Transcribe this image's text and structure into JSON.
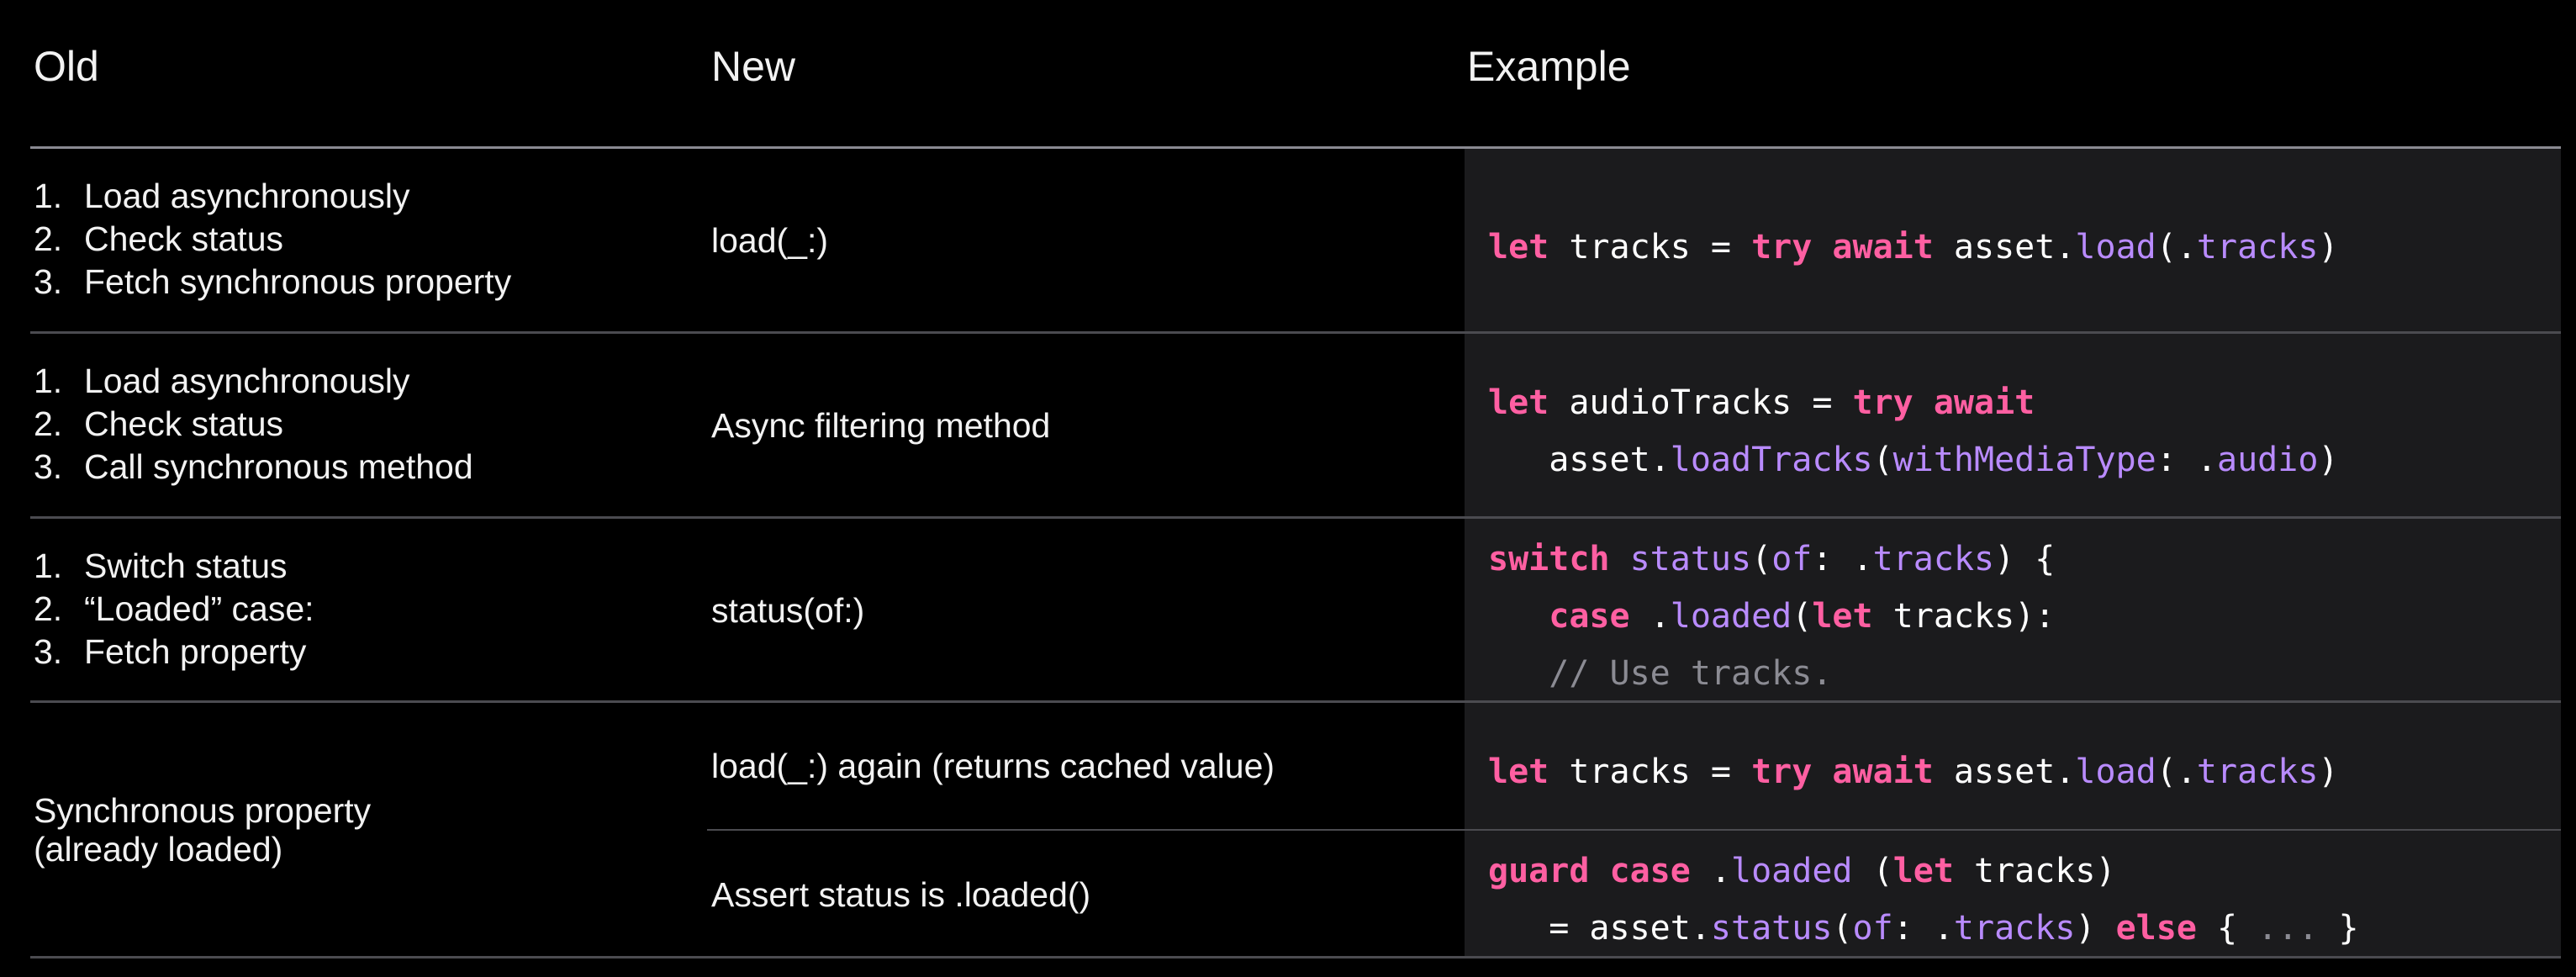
{
  "headers": {
    "old": "Old",
    "new": "New",
    "example": "Example"
  },
  "rows": [
    {
      "old_items": [
        {
          "num": "1.",
          "text": "Load asynchronously"
        },
        {
          "num": "2.",
          "text": "Check status"
        },
        {
          "num": "3.",
          "text": "Fetch synchronous property"
        }
      ],
      "new": "load(_:)",
      "code_lines": [
        [
          {
            "t": "let",
            "c": "kw"
          },
          {
            "t": " tracks = ",
            "c": "pl"
          },
          {
            "t": "try",
            "c": "kw"
          },
          {
            "t": " ",
            "c": "pl"
          },
          {
            "t": "await",
            "c": "kw"
          },
          {
            "t": " asset.",
            "c": "pl"
          },
          {
            "t": "load",
            "c": "fn"
          },
          {
            "t": "(.",
            "c": "pl"
          },
          {
            "t": "tracks",
            "c": "fn"
          },
          {
            "t": ")",
            "c": "pl"
          }
        ]
      ]
    },
    {
      "old_items": [
        {
          "num": "1.",
          "text": "Load asynchronously"
        },
        {
          "num": "2.",
          "text": "Check status"
        },
        {
          "num": "3.",
          "text": "Call synchronous method"
        }
      ],
      "new": "Async filtering method",
      "code_lines": [
        [
          {
            "t": "let",
            "c": "kw"
          },
          {
            "t": " audioTracks = ",
            "c": "pl"
          },
          {
            "t": "try",
            "c": "kw"
          },
          {
            "t": " ",
            "c": "pl"
          },
          {
            "t": "await",
            "c": "kw"
          }
        ],
        [
          {
            "t": "   asset.",
            "c": "pl"
          },
          {
            "t": "loadTracks",
            "c": "fn"
          },
          {
            "t": "(",
            "c": "pl"
          },
          {
            "t": "withMediaType",
            "c": "fn"
          },
          {
            "t": ": .",
            "c": "pl"
          },
          {
            "t": "audio",
            "c": "fn"
          },
          {
            "t": ")",
            "c": "pl"
          }
        ]
      ]
    },
    {
      "old_items": [
        {
          "num": "1.",
          "text": "Switch status"
        },
        {
          "num": "2.",
          "text": "“Loaded” case:"
        },
        {
          "num": "3.",
          "text": "Fetch property"
        }
      ],
      "new": "status(of:)",
      "code_lines": [
        [
          {
            "t": "switch",
            "c": "kw"
          },
          {
            "t": " ",
            "c": "pl"
          },
          {
            "t": "status",
            "c": "fn"
          },
          {
            "t": "(",
            "c": "pl"
          },
          {
            "t": "of",
            "c": "fn"
          },
          {
            "t": ": .",
            "c": "pl"
          },
          {
            "t": "tracks",
            "c": "fn"
          },
          {
            "t": ") {",
            "c": "pl"
          }
        ],
        [
          {
            "t": "   ",
            "c": "pl"
          },
          {
            "t": "case",
            "c": "kw"
          },
          {
            "t": " .",
            "c": "pl"
          },
          {
            "t": "loaded",
            "c": "fn"
          },
          {
            "t": "(",
            "c": "pl"
          },
          {
            "t": "let",
            "c": "kw"
          },
          {
            "t": " tracks):",
            "c": "pl"
          }
        ],
        [
          {
            "t": "   // Use tracks.",
            "c": "cm"
          }
        ]
      ]
    },
    {
      "old_text_1": "Synchronous property",
      "old_text_2": "(already loaded)",
      "sub_rows": [
        {
          "new": "load(_:) again (returns cached value)",
          "code_lines": [
            [
              {
                "t": "let",
                "c": "kw"
              },
              {
                "t": " tracks = ",
                "c": "pl"
              },
              {
                "t": "try",
                "c": "kw"
              },
              {
                "t": " ",
                "c": "pl"
              },
              {
                "t": "await",
                "c": "kw"
              },
              {
                "t": " asset.",
                "c": "pl"
              },
              {
                "t": "load",
                "c": "fn"
              },
              {
                "t": "(.",
                "c": "pl"
              },
              {
                "t": "tracks",
                "c": "fn"
              },
              {
                "t": ")",
                "c": "pl"
              }
            ]
          ]
        },
        {
          "new": "Assert status is .loaded()",
          "code_lines": [
            [
              {
                "t": "guard",
                "c": "kw"
              },
              {
                "t": " ",
                "c": "pl"
              },
              {
                "t": "case",
                "c": "kw"
              },
              {
                "t": " .",
                "c": "pl"
              },
              {
                "t": "loaded",
                "c": "fn"
              },
              {
                "t": " (",
                "c": "pl"
              },
              {
                "t": "let",
                "c": "kw"
              },
              {
                "t": " tracks)",
                "c": "pl"
              }
            ],
            [
              {
                "t": "   = asset.",
                "c": "pl"
              },
              {
                "t": "status",
                "c": "fn"
              },
              {
                "t": "(",
                "c": "pl"
              },
              {
                "t": "of",
                "c": "fn"
              },
              {
                "t": ": .",
                "c": "pl"
              },
              {
                "t": "tracks",
                "c": "fn"
              },
              {
                "t": ") ",
                "c": "pl"
              },
              {
                "t": "else",
                "c": "kw"
              },
              {
                "t": " { ",
                "c": "pl"
              },
              {
                "t": "...",
                "c": "cm"
              },
              {
                "t": " }",
                "c": "pl"
              }
            ]
          ]
        }
      ]
    }
  ],
  "colors": {
    "keyword": "#ff5fa2",
    "function": "#b98bff",
    "comment": "#8b8b93",
    "code_background": "#1b1b1d"
  }
}
